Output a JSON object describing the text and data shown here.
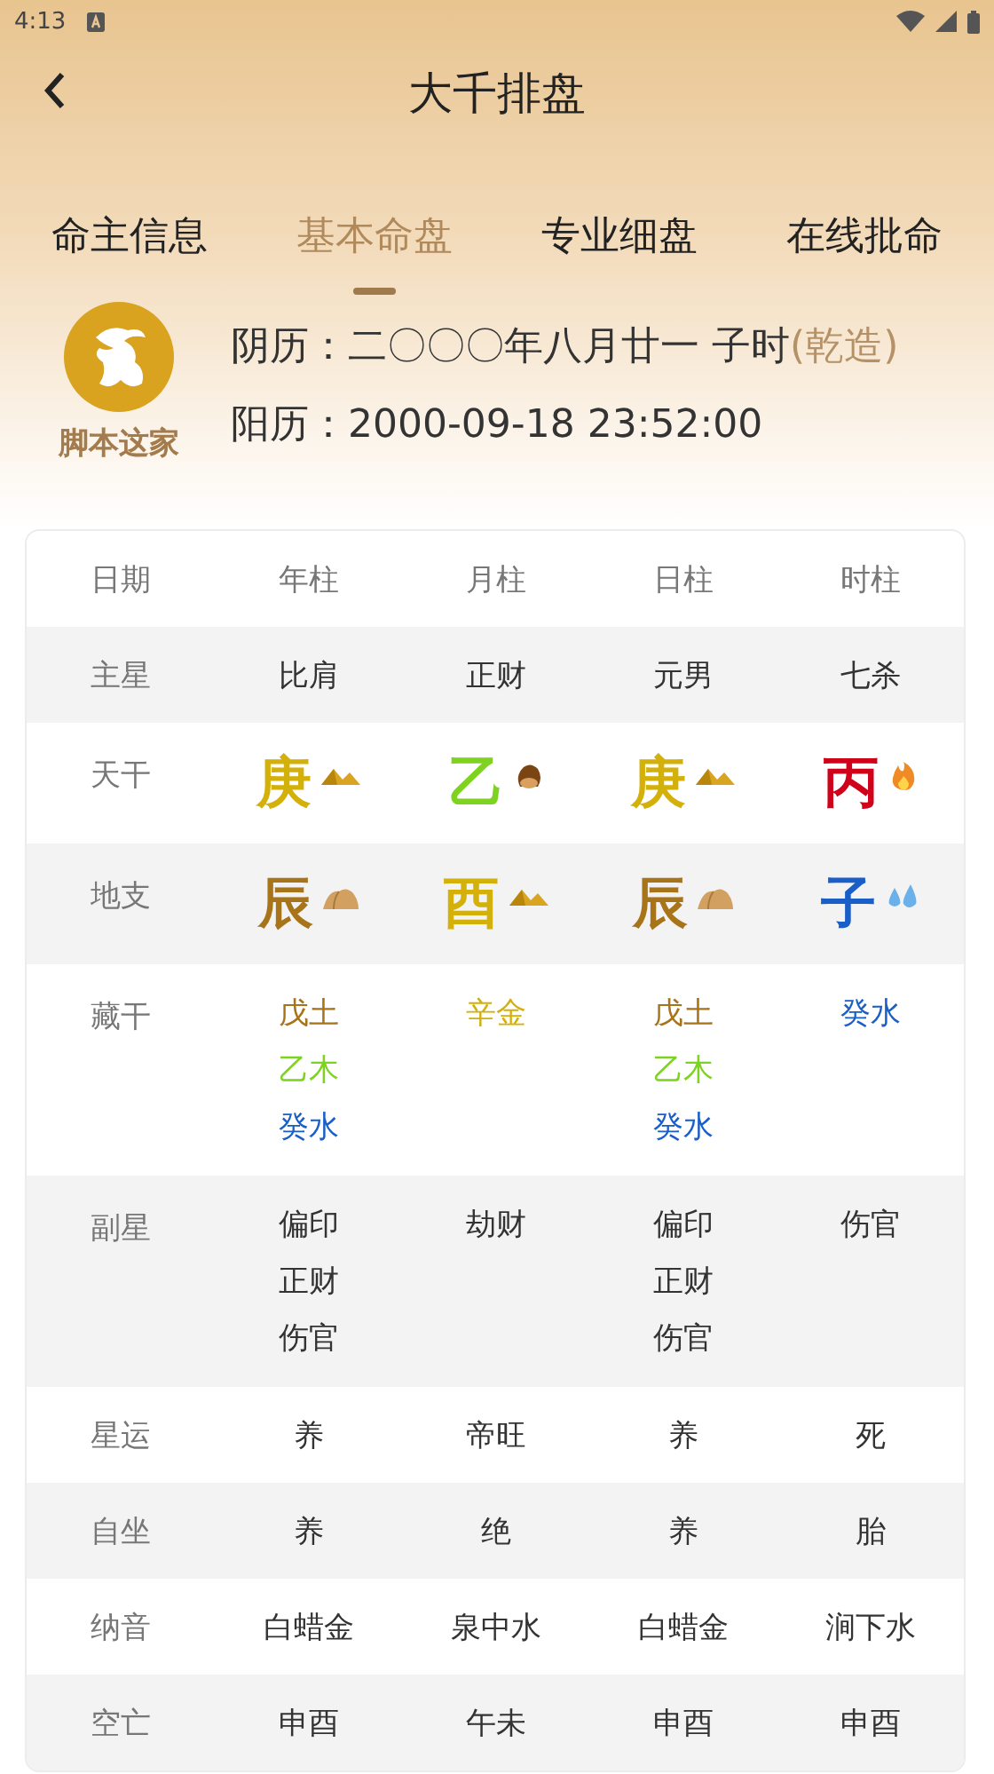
{
  "status_bar": {
    "time": "4:13"
  },
  "header": {
    "title": "大千排盘"
  },
  "tabs": [
    {
      "label": "命主信息",
      "selected": false
    },
    {
      "label": "基本命盘",
      "selected": true
    },
    {
      "label": "专业细盘",
      "selected": false
    },
    {
      "label": "在线批命",
      "selected": false
    }
  ],
  "profile": {
    "name": "脚本这家",
    "lunar_label": "阴历：",
    "lunar_value": "二〇〇〇年八月廿一 子时",
    "gender_tag": "(乾造)",
    "solar_label": "阳历：",
    "solar_value": "2000-09-18 23:52:00"
  },
  "table": {
    "columns": [
      "日期",
      "年柱",
      "月柱",
      "日柱",
      "时柱"
    ],
    "rows": [
      {
        "kind": "text",
        "cells": [
          "主星",
          "比肩",
          "正财",
          "元男",
          "七杀"
        ]
      },
      {
        "kind": "stem",
        "cells": [
          "天干",
          {
            "char": "庚",
            "color": "#d4b00a",
            "kind": "metal"
          },
          {
            "char": "乙",
            "color": "#7ed321",
            "kind": "wood"
          },
          {
            "char": "庚",
            "color": "#d4b00a",
            "kind": "metal"
          },
          {
            "char": "丙",
            "color": "#d0021b",
            "kind": "fire"
          }
        ]
      },
      {
        "kind": "stem",
        "cells": [
          "地支",
          {
            "char": "辰",
            "color": "#a8741a",
            "kind": "earth"
          },
          {
            "char": "酉",
            "color": "#d4b00a",
            "kind": "metal"
          },
          {
            "char": "辰",
            "color": "#a8741a",
            "kind": "earth"
          },
          {
            "char": "子",
            "color": "#1a5fc8",
            "kind": "water"
          }
        ]
      },
      {
        "kind": "multi",
        "cells": [
          "藏干",
          [
            {
              "text": "戊土",
              "color": "#a8741a"
            },
            {
              "text": "乙木",
              "color": "#7ed321"
            },
            {
              "text": "癸水",
              "color": "#1a5fc8"
            }
          ],
          [
            {
              "text": "辛金",
              "color": "#d4b00a"
            }
          ],
          [
            {
              "text": "戊土",
              "color": "#a8741a"
            },
            {
              "text": "乙木",
              "color": "#7ed321"
            },
            {
              "text": "癸水",
              "color": "#1a5fc8"
            }
          ],
          [
            {
              "text": "癸水",
              "color": "#1a5fc8"
            }
          ]
        ]
      },
      {
        "kind": "multi",
        "cells": [
          "副星",
          [
            {
              "text": "偏印"
            },
            {
              "text": "正财"
            },
            {
              "text": "伤官"
            }
          ],
          [
            {
              "text": "劫财"
            }
          ],
          [
            {
              "text": "偏印"
            },
            {
              "text": "正财"
            },
            {
              "text": "伤官"
            }
          ],
          [
            {
              "text": "伤官"
            }
          ]
        ]
      },
      {
        "kind": "text",
        "cells": [
          "星运",
          "养",
          "帝旺",
          "养",
          "死"
        ]
      },
      {
        "kind": "text",
        "cells": [
          "自坐",
          "养",
          "绝",
          "养",
          "胎"
        ]
      },
      {
        "kind": "text",
        "cells": [
          "纳音",
          "白蜡金",
          "泉中水",
          "白蜡金",
          "涧下水"
        ]
      },
      {
        "kind": "text",
        "cells": [
          "空亡",
          "申酉",
          "午未",
          "申酉",
          "申酉"
        ]
      }
    ]
  }
}
